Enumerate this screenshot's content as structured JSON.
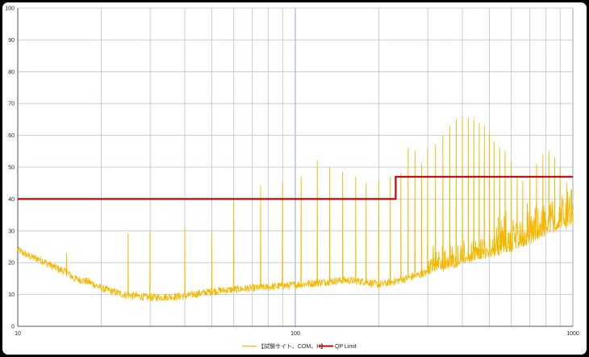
{
  "chart_data": {
    "type": "line",
    "title": "",
    "xlabel": "",
    "ylabel": "",
    "x_scale": "log",
    "xlim": [
      10,
      1000
    ],
    "ylim": [
      0,
      100
    ],
    "x_tick_labels": [
      "10",
      "100",
      "1000"
    ],
    "y_tick_labels": [
      "0",
      "10",
      "20",
      "30",
      "40",
      "50",
      "60",
      "70",
      "80",
      "90",
      "100"
    ],
    "grid": true,
    "legend_position": "bottom",
    "series": [
      {
        "name": "【試験サイト、COM、H】",
        "color": "#F5B800",
        "baseline": [
          [
            10,
            24
          ],
          [
            11,
            22
          ],
          [
            12,
            21
          ],
          [
            14,
            18
          ],
          [
            15,
            17
          ],
          [
            16,
            15
          ],
          [
            18,
            14
          ],
          [
            20,
            12
          ],
          [
            24,
            10
          ],
          [
            30,
            9
          ],
          [
            40,
            9.5
          ],
          [
            50,
            11
          ],
          [
            70,
            12
          ],
          [
            100,
            13
          ],
          [
            130,
            14
          ],
          [
            150,
            14.5
          ],
          [
            180,
            14
          ],
          [
            200,
            13
          ],
          [
            250,
            15
          ],
          [
            300,
            17
          ],
          [
            400,
            20
          ],
          [
            500,
            22
          ],
          [
            600,
            24
          ],
          [
            700,
            26
          ],
          [
            800,
            29
          ],
          [
            900,
            31
          ],
          [
            1000,
            32
          ]
        ],
        "peaks": [
          [
            15,
            23
          ],
          [
            25,
            29
          ],
          [
            30,
            30
          ],
          [
            40,
            31
          ],
          [
            50,
            30
          ],
          [
            60,
            39
          ],
          [
            75,
            44
          ],
          [
            90,
            45
          ],
          [
            105,
            47
          ],
          [
            120,
            52
          ],
          [
            133,
            50
          ],
          [
            148,
            48.5
          ],
          [
            165,
            47
          ],
          [
            180,
            45
          ],
          [
            200,
            46
          ],
          [
            220,
            47
          ],
          [
            240,
            48
          ],
          [
            255,
            56
          ],
          [
            270,
            55
          ],
          [
            285,
            51
          ],
          [
            300,
            55.5
          ],
          [
            320,
            57
          ],
          [
            340,
            60
          ],
          [
            360,
            63
          ],
          [
            380,
            65
          ],
          [
            400,
            65.5
          ],
          [
            420,
            65.5
          ],
          [
            440,
            65
          ],
          [
            460,
            64
          ],
          [
            480,
            63
          ],
          [
            500,
            61
          ],
          [
            520,
            58
          ],
          [
            545,
            56
          ],
          [
            570,
            55
          ],
          [
            600,
            52
          ],
          [
            630,
            47
          ],
          [
            660,
            45.5
          ],
          [
            700,
            47
          ],
          [
            740,
            51
          ],
          [
            780,
            54
          ],
          [
            820,
            55
          ],
          [
            860,
            53
          ],
          [
            900,
            50
          ],
          [
            950,
            45
          ],
          [
            990,
            43
          ]
        ]
      },
      {
        "name": "QP Limit",
        "color": "#CC0000",
        "points": [
          [
            10,
            40
          ],
          [
            230,
            40
          ],
          [
            230,
            47
          ],
          [
            1000,
            47
          ]
        ]
      }
    ]
  }
}
